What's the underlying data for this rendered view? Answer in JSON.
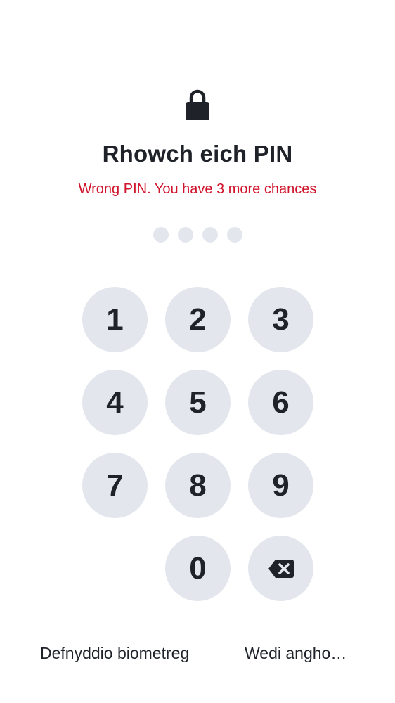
{
  "header": {
    "icon": "lock-icon",
    "title": "Rhowch eich PIN",
    "error": "Wrong PIN. You have 3 more chances"
  },
  "pin": {
    "length": 4,
    "entered": 0
  },
  "keypad": {
    "keys": [
      "1",
      "2",
      "3",
      "4",
      "5",
      "6",
      "7",
      "8",
      "9",
      "0"
    ],
    "backspace_icon": "backspace-icon"
  },
  "footer": {
    "biometric_label": "Defnyddio biometreg",
    "forgot_label": "Wedi angho…"
  },
  "colors": {
    "error": "#d0142c",
    "key_bg": "#e3e7ed",
    "text": "#1f2329"
  }
}
